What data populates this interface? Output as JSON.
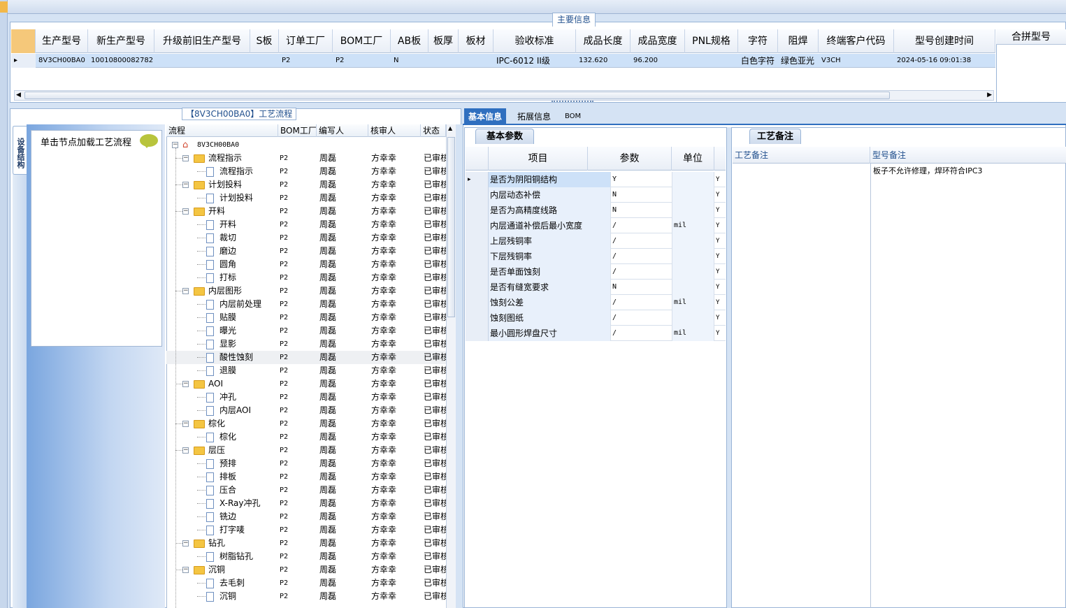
{
  "main_info": {
    "legend": "主要信息",
    "columns": [
      "生产型号",
      "新生产型号",
      "升级前旧生产型号",
      "S板",
      "订单工厂",
      "BOM工厂",
      "AB板",
      "板厚",
      "板材",
      "验收标准",
      "成品长度",
      "成品宽度",
      "PNL规格",
      "字符",
      "阻焊",
      "终端客户代码",
      "型号创建时间"
    ],
    "row": [
      "8V3CH00BA0",
      "10010800082782",
      "",
      "",
      "P2",
      "P2",
      "N",
      "",
      "",
      "IPC-6012 II级",
      "132.620",
      "96.200",
      "",
      "白色字符",
      "绿色亚光",
      "V3CH",
      "2024-05-16 09:01:38"
    ],
    "merge_header": "合拼型号"
  },
  "flow": {
    "legend": "【8V3CH00BA0】工艺流程",
    "side_tab": "设备结构",
    "hint": "单击节点加载工艺流程",
    "columns": [
      "流程",
      "BOM工厂",
      "编写人",
      "核审人",
      "状态"
    ],
    "root": "8V3CH00BA0",
    "rows": [
      {
        "level": 1,
        "type": "folder",
        "name": "流程指示",
        "bom": "P2",
        "writer": "周磊",
        "reviewer": "方幸幸",
        "status": "已审核"
      },
      {
        "level": 2,
        "type": "doc",
        "name": "流程指示",
        "bom": "P2",
        "writer": "周磊",
        "reviewer": "方幸幸",
        "status": "已审核"
      },
      {
        "level": 1,
        "type": "folder",
        "name": "计划投料",
        "bom": "P2",
        "writer": "周磊",
        "reviewer": "方幸幸",
        "status": "已审核"
      },
      {
        "level": 2,
        "type": "doc",
        "name": "计划投料",
        "bom": "P2",
        "writer": "周磊",
        "reviewer": "方幸幸",
        "status": "已审核"
      },
      {
        "level": 1,
        "type": "folder",
        "name": "开料",
        "bom": "P2",
        "writer": "周磊",
        "reviewer": "方幸幸",
        "status": "已审核"
      },
      {
        "level": 2,
        "type": "doc",
        "name": "开料",
        "bom": "P2",
        "writer": "周磊",
        "reviewer": "方幸幸",
        "status": "已审核"
      },
      {
        "level": 2,
        "type": "doc",
        "name": "裁切",
        "bom": "P2",
        "writer": "周磊",
        "reviewer": "方幸幸",
        "status": "已审核"
      },
      {
        "level": 2,
        "type": "doc",
        "name": "磨边",
        "bom": "P2",
        "writer": "周磊",
        "reviewer": "方幸幸",
        "status": "已审核"
      },
      {
        "level": 2,
        "type": "doc",
        "name": "圆角",
        "bom": "P2",
        "writer": "周磊",
        "reviewer": "方幸幸",
        "status": "已审核"
      },
      {
        "level": 2,
        "type": "doc",
        "name": "打标",
        "bom": "P2",
        "writer": "周磊",
        "reviewer": "方幸幸",
        "status": "已审核"
      },
      {
        "level": 1,
        "type": "folder",
        "name": "内层图形",
        "bom": "P2",
        "writer": "周磊",
        "reviewer": "方幸幸",
        "status": "已审核"
      },
      {
        "level": 2,
        "type": "doc",
        "name": "内层前处理",
        "bom": "P2",
        "writer": "周磊",
        "reviewer": "方幸幸",
        "status": "已审核"
      },
      {
        "level": 2,
        "type": "doc",
        "name": "贴膜",
        "bom": "P2",
        "writer": "周磊",
        "reviewer": "方幸幸",
        "status": "已审核"
      },
      {
        "level": 2,
        "type": "doc",
        "name": "曝光",
        "bom": "P2",
        "writer": "周磊",
        "reviewer": "方幸幸",
        "status": "已审核"
      },
      {
        "level": 2,
        "type": "doc",
        "name": "显影",
        "bom": "P2",
        "writer": "周磊",
        "reviewer": "方幸幸",
        "status": "已审核"
      },
      {
        "level": 2,
        "type": "doc",
        "name": "酸性蚀刻",
        "bom": "P2",
        "writer": "周磊",
        "reviewer": "方幸幸",
        "status": "已审核",
        "selected": true
      },
      {
        "level": 2,
        "type": "doc",
        "name": "退膜",
        "bom": "P2",
        "writer": "周磊",
        "reviewer": "方幸幸",
        "status": "已审核"
      },
      {
        "level": 1,
        "type": "folder",
        "name": "AOI",
        "bom": "P2",
        "writer": "周磊",
        "reviewer": "方幸幸",
        "status": "已审核"
      },
      {
        "level": 2,
        "type": "doc",
        "name": "冲孔",
        "bom": "P2",
        "writer": "周磊",
        "reviewer": "方幸幸",
        "status": "已审核"
      },
      {
        "level": 2,
        "type": "doc",
        "name": "内层AOI",
        "bom": "P2",
        "writer": "周磊",
        "reviewer": "方幸幸",
        "status": "已审核"
      },
      {
        "level": 1,
        "type": "folder",
        "name": "棕化",
        "bom": "P2",
        "writer": "周磊",
        "reviewer": "方幸幸",
        "status": "已审核"
      },
      {
        "level": 2,
        "type": "doc",
        "name": "棕化",
        "bom": "P2",
        "writer": "周磊",
        "reviewer": "方幸幸",
        "status": "已审核"
      },
      {
        "level": 1,
        "type": "folder",
        "name": "层压",
        "bom": "P2",
        "writer": "周磊",
        "reviewer": "方幸幸",
        "status": "已审核"
      },
      {
        "level": 2,
        "type": "doc",
        "name": "预排",
        "bom": "P2",
        "writer": "周磊",
        "reviewer": "方幸幸",
        "status": "已审核"
      },
      {
        "level": 2,
        "type": "doc",
        "name": "排板",
        "bom": "P2",
        "writer": "周磊",
        "reviewer": "方幸幸",
        "status": "已审核"
      },
      {
        "level": 2,
        "type": "doc",
        "name": "压合",
        "bom": "P2",
        "writer": "周磊",
        "reviewer": "方幸幸",
        "status": "已审核"
      },
      {
        "level": 2,
        "type": "doc",
        "name": "X-Ray冲孔",
        "bom": "P2",
        "writer": "周磊",
        "reviewer": "方幸幸",
        "status": "已审核"
      },
      {
        "level": 2,
        "type": "doc",
        "name": "铣边",
        "bom": "P2",
        "writer": "周磊",
        "reviewer": "方幸幸",
        "status": "已审核"
      },
      {
        "level": 2,
        "type": "doc",
        "name": "打字唛",
        "bom": "P2",
        "writer": "周磊",
        "reviewer": "方幸幸",
        "status": "已审核"
      },
      {
        "level": 1,
        "type": "folder",
        "name": "钻孔",
        "bom": "P2",
        "writer": "周磊",
        "reviewer": "方幸幸",
        "status": "已审核"
      },
      {
        "level": 2,
        "type": "doc",
        "name": "树脂钻孔",
        "bom": "P2",
        "writer": "周磊",
        "reviewer": "方幸幸",
        "status": "已审核"
      },
      {
        "level": 1,
        "type": "folder",
        "name": "沉铜",
        "bom": "P2",
        "writer": "周磊",
        "reviewer": "方幸幸",
        "status": "已审核"
      },
      {
        "level": 2,
        "type": "doc",
        "name": "去毛刺",
        "bom": "P2",
        "writer": "周磊",
        "reviewer": "方幸幸",
        "status": "已审核"
      },
      {
        "level": 2,
        "type": "doc",
        "name": "沉铜",
        "bom": "P2",
        "writer": "周磊",
        "reviewer": "方幸幸",
        "status": "已审核"
      }
    ]
  },
  "tabs": [
    "基本信息",
    "拓展信息",
    "BOM"
  ],
  "basic": {
    "title": "基本参数",
    "columns": [
      "项目",
      "参数",
      "单位"
    ],
    "rows": [
      {
        "item": "是否为阴阳铜结构",
        "param": "Y",
        "unit": "",
        "flag": "Y"
      },
      {
        "item": "内层动态补偿",
        "param": "N",
        "unit": "",
        "flag": "Y"
      },
      {
        "item": "是否为高精度线路",
        "param": "N",
        "unit": "",
        "flag": "Y"
      },
      {
        "item": "内层通道补偿后最小宽度",
        "param": "/",
        "unit": "mil",
        "flag": "Y"
      },
      {
        "item": "上层残铜率",
        "param": "/",
        "unit": "",
        "flag": "Y"
      },
      {
        "item": "下层残铜率",
        "param": "/",
        "unit": "",
        "flag": "Y"
      },
      {
        "item": "是否单面蚀刻",
        "param": "/",
        "unit": "",
        "flag": "Y"
      },
      {
        "item": "是否有缝宽要求",
        "param": "N",
        "unit": "",
        "flag": "Y"
      },
      {
        "item": "蚀刻公差",
        "param": "/",
        "unit": "mil",
        "flag": "Y"
      },
      {
        "item": "蚀刻图纸",
        "param": "/",
        "unit": "",
        "flag": "Y"
      },
      {
        "item": "最小圆形焊盘尺寸",
        "param": "/",
        "unit": "mil",
        "flag": "Y"
      }
    ]
  },
  "notes": {
    "title": "工艺备注",
    "col1": "工艺备注",
    "col2": "型号备注",
    "model_note": "板子不允许修理，焊环符合IPC3"
  }
}
